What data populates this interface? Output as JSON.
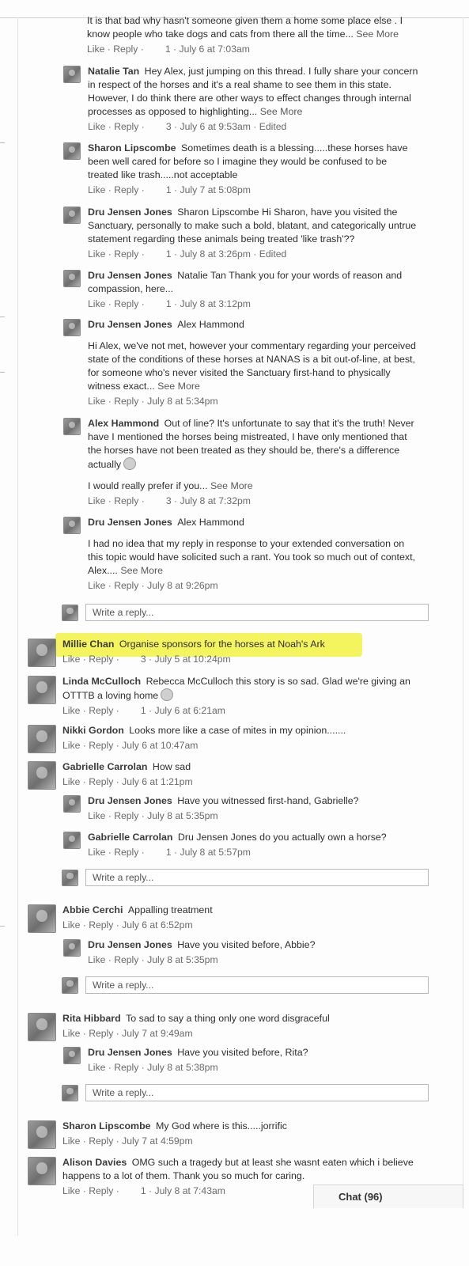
{
  "comments": [
    {
      "name": "",
      "text": "It is that bad why hasn't someone given them a home some place else . I know people who take dogs and cats from there all the time...",
      "more": "See More",
      "meta": "Like · Reply ·        1 · July 6 at 7:03am"
    },
    {
      "name": "Natalie Tan",
      "text": "Hey Alex, just jumping on this thread. I fully share your concern in respect of the horses and it's a real shame to see them in this state. However, I do think there are other ways to effect changes through internal processes as opposed to highlighting...",
      "more": "See More",
      "meta": "Like · Reply ·        3 · July 6 at 9:53am · Edited"
    },
    {
      "name": "Sharon Lipscombe",
      "text": "Sometimes death is a blessing.....these horses have been well cared for before so I imagine they would be confused to be treated like trash.....not acceptable",
      "meta": "Like · Reply ·        1 · July 7 at 5:08pm"
    },
    {
      "name": "Dru Jensen Jones",
      "text": "Sharon Lipscombe Hi Sharon, have you visited the Sanctuary, personally to make such a bold, blatant, and categorically untrue statement regarding these animals being treated 'like trash'??",
      "meta": "Like · Reply ·        1 · July 8 at 3:26pm · Edited"
    },
    {
      "name": "Dru Jensen Jones",
      "text": "Natalie Tan Thank you for your words of reason and compassion, here...",
      "meta": "Like · Reply ·        1 · July 8 at 3:12pm"
    },
    {
      "name": "Dru Jensen Jones",
      "text": "Alex Hammond",
      "text2": "Hi Alex, we've not met, however your commentary regarding your perceived state of the conditions of these horses at NANAS is a bit out-of-line, at best, for someone who's never visited the Sanctuary first-hand to physically witness exact...",
      "more": "See More",
      "meta": "Like · Reply · July 8 at 5:34pm"
    },
    {
      "name": "Alex Hammond",
      "text": "Out of line? It's unfortunate to say that it's the truth! Never have I mentioned the horses being mistreated, I have only mentioned that the horses have not been treated as they should be, there's a difference actually",
      "text2": "I would really prefer if you...",
      "more": "See More",
      "meta": "Like · Reply ·        3 · July 8 at 7:32pm"
    },
    {
      "name": "Dru Jensen Jones",
      "text": "Alex Hammond",
      "text2": "I had no idea that my reply in response to your extended conversation on this topic would have solicited such a rant. You took so much out of context, Alex....",
      "more": "See More",
      "meta": "Like · Reply · July 8 at 9:26pm"
    },
    {
      "name": "Millie Chan",
      "text": "Organise sponsors for the horses at Noah's Ark",
      "meta": "Like · Reply ·        3 · July 5 at 10:24pm"
    },
    {
      "name": "Linda McCulloch",
      "text": "Rebecca McCulloch this story is so sad. Glad we're giving an OTTTB a loving home",
      "meta": "Like · Reply ·        1 · July 6 at 6:21am"
    },
    {
      "name": "Nikki Gordon",
      "text": "Looks more like a case of mites in my opinion.......",
      "meta": "Like · Reply · July 6 at 10:47am"
    },
    {
      "name": "Gabrielle Carrolan",
      "text": "How sad",
      "meta": "Like · Reply · July 6 at 1:21pm"
    },
    {
      "name": "Dru Jensen Jones",
      "text": "Have you witnessed first-hand, Gabrielle?",
      "meta": "Like · Reply · July 8 at 5:35pm"
    },
    {
      "name": "Gabrielle Carrolan",
      "text": "Dru Jensen Jones do you actually own a horse?",
      "meta": "Like · Reply ·        1 · July 8 at 5:57pm"
    },
    {
      "name": "Abbie Cerchi",
      "text": "Appalling treatment",
      "meta": "Like · Reply · July 6 at 6:52pm"
    },
    {
      "name": "Dru Jensen Jones",
      "text": "Have you visited before, Abbie?",
      "meta": "Like · Reply · July 8 at 5:35pm"
    },
    {
      "name": "Rita Hibbard",
      "text": "To sad to say a thing only one word disgraceful",
      "meta": "Like · Reply · July 7 at 9:49am"
    },
    {
      "name": "Dru Jensen Jones",
      "text": "Have you visited before, Rita?",
      "meta": "Like · Reply · July 8 at 5:38pm"
    },
    {
      "name": "Sharon Lipscombe",
      "text": "My God where is this.....jorrific",
      "meta": "Like · Reply · July 7 at 4:59pm"
    },
    {
      "name": "Alison Davies",
      "text": "OMG such a tragedy but at least she wasnt eaten which i believe happens to a lot of them. Thank you so much for caring.",
      "meta": "Like · Reply ·        1 · July 8 at 7:43am"
    }
  ],
  "reply_placeholder": "Write a reply...",
  "chat_label": "Chat (96)",
  "highlight_color": "#f4f45e"
}
